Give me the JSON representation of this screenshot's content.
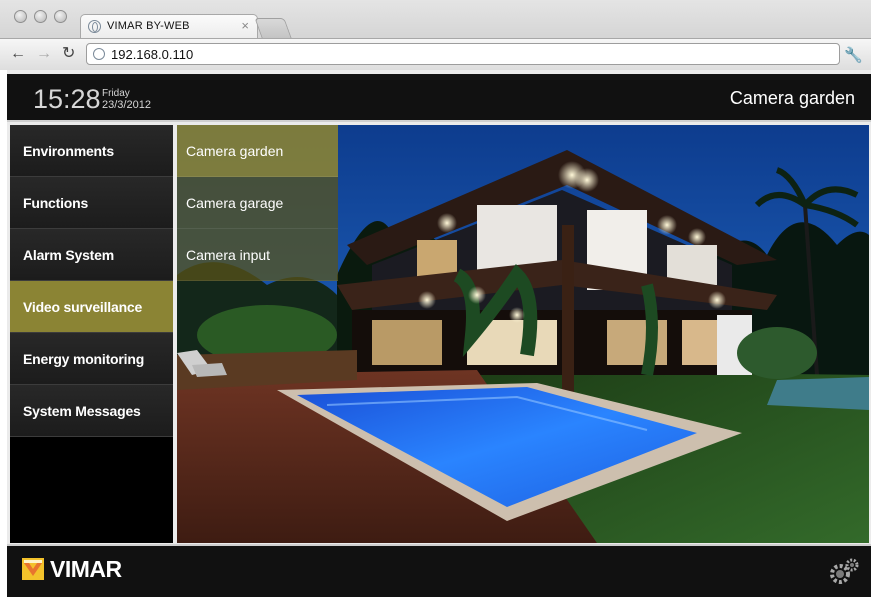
{
  "browser": {
    "tab_title": "VIMAR BY-WEB",
    "url": "192.168.0.110",
    "tab_close": "×"
  },
  "header": {
    "time": "15:28",
    "weekday": "Friday",
    "date": "23/3/2012",
    "title": "Camera garden"
  },
  "sidebar": {
    "items": [
      {
        "label": "Environments"
      },
      {
        "label": "Functions"
      },
      {
        "label": "Alarm System"
      },
      {
        "label": "Video surveillance",
        "active": true
      },
      {
        "label": "Energy monitoring"
      },
      {
        "label": "System Messages"
      }
    ]
  },
  "cameras": {
    "items": [
      {
        "label": "Camera garden",
        "active": true
      },
      {
        "label": "Camera garage"
      },
      {
        "label": "Camera input"
      }
    ]
  },
  "footer": {
    "brand": "VIMAR",
    "settings_icon": "gear-icon"
  },
  "colors": {
    "accent": "#8b8434",
    "header_bg": "#111111",
    "pool": "#2a84ff"
  }
}
